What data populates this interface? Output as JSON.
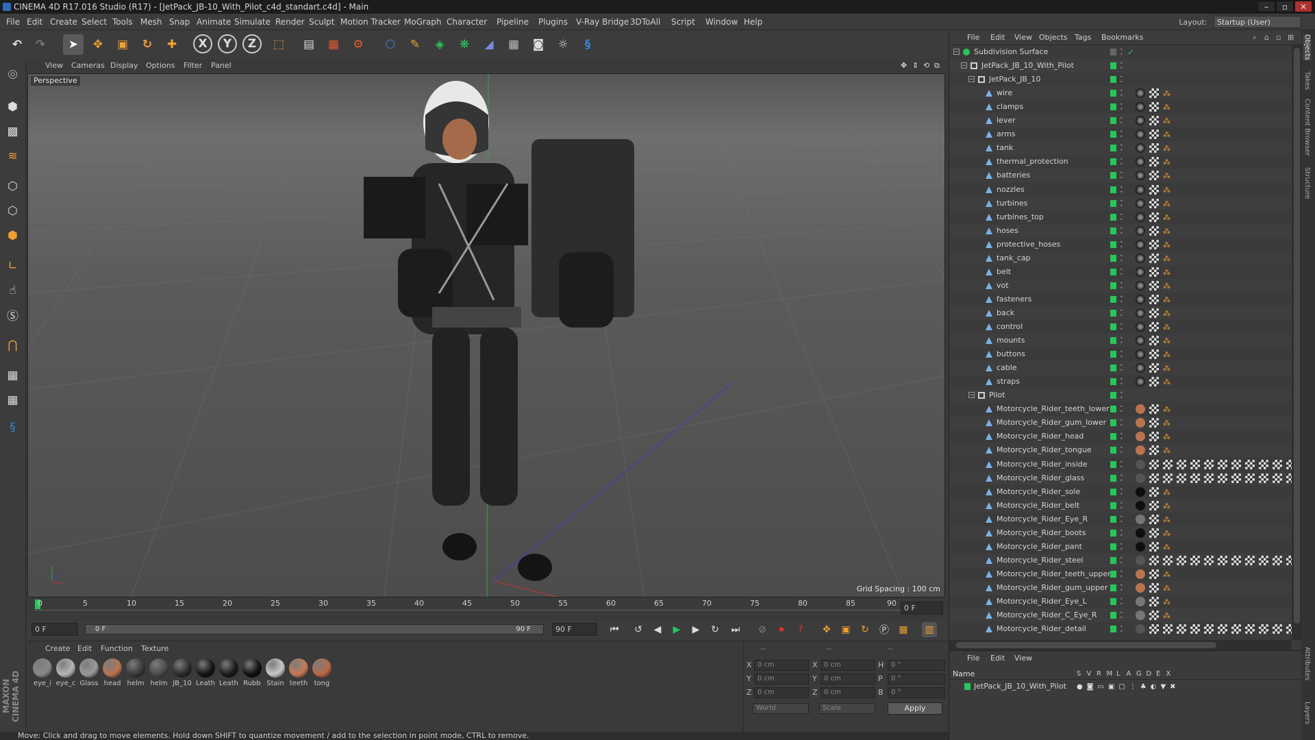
{
  "window": {
    "title": "CINEMA 4D R17.016 Studio (R17) - [JetPack_JB-10_With_Pilot_c4d_standart.c4d] - Main",
    "minimize": "–",
    "maximize": "▫",
    "close": "✕"
  },
  "menubar": {
    "items": [
      "File",
      "Edit",
      "Create",
      "Select",
      "Tools",
      "Mesh",
      "Snap",
      "Animate",
      "Simulate",
      "Render",
      "Sculpt",
      "Motion Tracker",
      "MoGraph",
      "Character",
      "Pipeline",
      "Plugins",
      "V-Ray Bridge",
      "3DToAll",
      "Script",
      "Window",
      "Help"
    ],
    "layout_label": "Layout:",
    "layout_value": "Startup (User)"
  },
  "toolbar": {
    "undo_icon": "undo-icon",
    "axis_x": "X",
    "axis_y": "Y",
    "axis_z": "Z"
  },
  "viewport": {
    "menu": [
      "View",
      "Cameras",
      "Display",
      "Options",
      "Filter",
      "Panel"
    ],
    "label": "Perspective",
    "grid_spacing": "Grid Spacing : 100 cm"
  },
  "timeline": {
    "ticks": [
      "0",
      "5",
      "10",
      "15",
      "20",
      "25",
      "30",
      "35",
      "40",
      "45",
      "50",
      "55",
      "60",
      "65",
      "70",
      "75",
      "80",
      "85",
      "90"
    ],
    "current_frame": "0 F",
    "start_frame": "0 F",
    "range_start": "0 F",
    "range_end": "90 F",
    "end_frame": "90 F"
  },
  "materials": {
    "menu": [
      "Create",
      "Edit",
      "Function",
      "Texture"
    ],
    "items": [
      {
        "label": "eye_i",
        "color": "#8a8a8a"
      },
      {
        "label": "eye_c",
        "color": "#b5b5b5"
      },
      {
        "label": "Glass",
        "color": "#9a9a9a"
      },
      {
        "label": "head",
        "color": "#b9744f"
      },
      {
        "label": "helm",
        "color": "#3a3a3a"
      },
      {
        "label": "helm",
        "color": "#4a4a4a"
      },
      {
        "label": "JB_10",
        "color": "#2c2c2c"
      },
      {
        "label": "Leath",
        "color": "#141414"
      },
      {
        "label": "Leath",
        "color": "#1a1a1a"
      },
      {
        "label": "Rubb",
        "color": "#111111"
      },
      {
        "label": "Stain",
        "color": "#c8c8c8"
      },
      {
        "label": "teeth",
        "color": "#c77a55"
      },
      {
        "label": "tong",
        "color": "#b86a48"
      }
    ]
  },
  "coordinates": {
    "header_1": "--",
    "header_2": "--",
    "header_3": "--",
    "pos_x_label": "X",
    "pos_x": "0 cm",
    "pos_y_label": "Y",
    "pos_y": "0 cm",
    "pos_z_label": "Z",
    "pos_z": "0 cm",
    "size_x_label": "X",
    "size_x": "0 cm",
    "size_y_label": "Y",
    "size_y": "0 cm",
    "size_z_label": "Z",
    "size_z": "0 cm",
    "rot_h_label": "H",
    "rot_h": "0 °",
    "rot_p_label": "P",
    "rot_p": "0 °",
    "rot_b_label": "B",
    "rot_b": "0 °",
    "space_select": "World",
    "mode_select": "Scale",
    "apply_label": "Apply"
  },
  "status": "Move: Click and drag to move elements. Hold down SHIFT to quantize movement / add to the selection in point mode, CTRL to remove.",
  "object_manager": {
    "menu": [
      "File",
      "Edit",
      "View",
      "Objects",
      "Tags",
      "Bookmarks"
    ],
    "objects": [
      {
        "name": "Subdivision Surface",
        "depth": 0,
        "tags": "none"
      },
      {
        "name": "JetPack_JB_10_With_Pilot",
        "depth": 1,
        "tags": "none"
      },
      {
        "name": "JetPack_JB_10",
        "depth": 2,
        "tags": "none"
      },
      {
        "name": "wire",
        "depth": 3,
        "tags": "std"
      },
      {
        "name": "clamps",
        "depth": 3,
        "tags": "std"
      },
      {
        "name": "lever",
        "depth": 3,
        "tags": "std"
      },
      {
        "name": "arms",
        "depth": 3,
        "tags": "std"
      },
      {
        "name": "tank",
        "depth": 3,
        "tags": "std"
      },
      {
        "name": "thermal_protection",
        "depth": 3,
        "tags": "std"
      },
      {
        "name": "batteries",
        "depth": 3,
        "tags": "std"
      },
      {
        "name": "nozzles",
        "depth": 3,
        "tags": "std"
      },
      {
        "name": "turbines",
        "depth": 3,
        "tags": "std"
      },
      {
        "name": "turbines_top",
        "depth": 3,
        "tags": "std"
      },
      {
        "name": "hoses",
        "depth": 3,
        "tags": "std"
      },
      {
        "name": "protective_hoses",
        "depth": 3,
        "tags": "std"
      },
      {
        "name": "tank_cap",
        "depth": 3,
        "tags": "std"
      },
      {
        "name": "belt",
        "depth": 3,
        "tags": "std"
      },
      {
        "name": "vot",
        "depth": 3,
        "tags": "std"
      },
      {
        "name": "fasteners",
        "depth": 3,
        "tags": "std"
      },
      {
        "name": "back",
        "depth": 3,
        "tags": "std"
      },
      {
        "name": "control",
        "depth": 3,
        "tags": "std"
      },
      {
        "name": "mounts",
        "depth": 3,
        "tags": "std"
      },
      {
        "name": "buttons",
        "depth": 3,
        "tags": "std"
      },
      {
        "name": "cable",
        "depth": 3,
        "tags": "std"
      },
      {
        "name": "straps",
        "depth": 3,
        "tags": "std"
      },
      {
        "name": "Pilot",
        "depth": 2,
        "tags": "none"
      },
      {
        "name": "Motorcycle_Rider_teeth_lower",
        "depth": 3,
        "tags": "skin"
      },
      {
        "name": "Motorcycle_Rider_gum_lower",
        "depth": 3,
        "tags": "skin"
      },
      {
        "name": "Motorcycle_Rider_head",
        "depth": 3,
        "tags": "skin"
      },
      {
        "name": "Motorcycle_Rider_tongue",
        "depth": 3,
        "tags": "skin"
      },
      {
        "name": "Motorcycle_Rider_inside",
        "depth": 3,
        "tags": "multi"
      },
      {
        "name": "Motorcycle_Rider_glass",
        "depth": 3,
        "tags": "multi"
      },
      {
        "name": "Motorcycle_Rider_sole",
        "depth": 3,
        "tags": "dark"
      },
      {
        "name": "Motorcycle_Rider_belt",
        "depth": 3,
        "tags": "dark"
      },
      {
        "name": "Motorcycle_Rider_Eye_R",
        "depth": 3,
        "tags": "eye"
      },
      {
        "name": "Motorcycle_Rider_boots",
        "depth": 3,
        "tags": "dark"
      },
      {
        "name": "Motorcycle_Rider_pant",
        "depth": 3,
        "tags": "dark"
      },
      {
        "name": "Motorcycle_Rider_steel",
        "depth": 3,
        "tags": "multi"
      },
      {
        "name": "Motorcycle_Rider_teeth_upper",
        "depth": 3,
        "tags": "skin"
      },
      {
        "name": "Motorcycle_Rider_gum_upper",
        "depth": 3,
        "tags": "skin"
      },
      {
        "name": "Motorcycle_Rider_Eye_L",
        "depth": 3,
        "tags": "eye"
      },
      {
        "name": "Motorcycle_Rider_C_Eye_R",
        "depth": 3,
        "tags": "eye"
      },
      {
        "name": "Motorcycle_Rider_detail",
        "depth": 3,
        "tags": "multi"
      }
    ]
  },
  "layer_manager": {
    "menu": [
      "File",
      "Edit",
      "View"
    ],
    "name_header": "Name",
    "columns": [
      "S",
      "V",
      "R",
      "M",
      "L",
      "A",
      "G",
      "D",
      "E",
      "X"
    ],
    "row_name": "JetPack_JB_10_With_Pilot"
  },
  "side_tabs": [
    "Objects",
    "Takes",
    "Content Browser",
    "Structure",
    "Attributes",
    "Layers"
  ],
  "brand": "MAXON CINEMA 4D",
  "colors": {
    "accent_green": "#27c65a",
    "accent_orange": "#f0a030",
    "accent_blue": "#3b84d6"
  }
}
